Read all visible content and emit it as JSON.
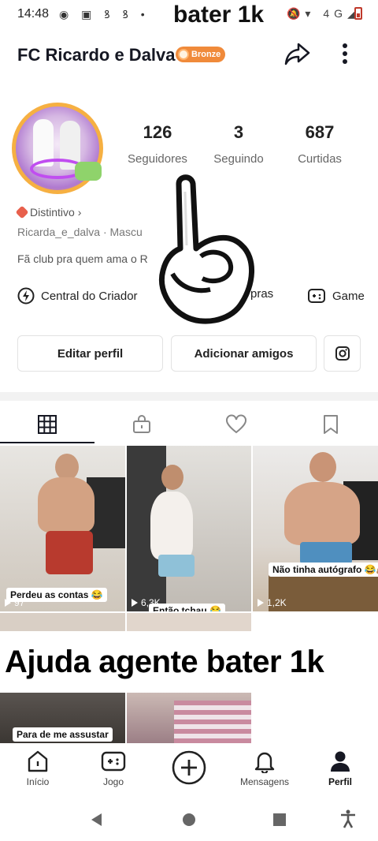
{
  "status_bar": {
    "time": "14:48",
    "overlay_text": "bater 1k",
    "network": "4G"
  },
  "header": {
    "title": "FC Ricardo e Dalva",
    "badge": "Bronze",
    "share_icon": "share-arrow-icon",
    "menu_icon": "more-vertical-icon"
  },
  "stats": [
    {
      "value": "126",
      "label": "Seguidores"
    },
    {
      "value": "3",
      "label": "Seguindo"
    },
    {
      "value": "687",
      "label": "Curtidas"
    }
  ],
  "profile": {
    "distintivo": "Distintivo",
    "handle": "Ricarda_e_dalva  ·  Mascu",
    "bio": "Fã club pra quem ama o R"
  },
  "links": {
    "creator": "Central do Criador",
    "shopping": "pras",
    "game": "Game"
  },
  "buttons": {
    "edit": "Editar perfil",
    "add_friends": "Adicionar amigos"
  },
  "videos": [
    {
      "caption": "Perdeu as contas 😂",
      "views": "97"
    },
    {
      "caption": "Então tchau 😂",
      "views": "6,3K"
    },
    {
      "caption": "Não tinha autógrafo 😂🙈",
      "views": "1,2K"
    },
    {
      "caption": "Para de me assustar",
      "views": ""
    }
  ],
  "overlay_banner": "Ajuda agente bater 1k",
  "nav": [
    {
      "label": "Início",
      "icon": "home-icon"
    },
    {
      "label": "Jogo",
      "icon": "gamepad-icon"
    },
    {
      "label": "",
      "icon": "plus-circle-icon"
    },
    {
      "label": "Mensagens",
      "icon": "bell-icon"
    },
    {
      "label": "Perfil",
      "icon": "person-icon"
    }
  ],
  "colors": {
    "badge": "#f08a3a",
    "accent_red": "#e8604c"
  }
}
